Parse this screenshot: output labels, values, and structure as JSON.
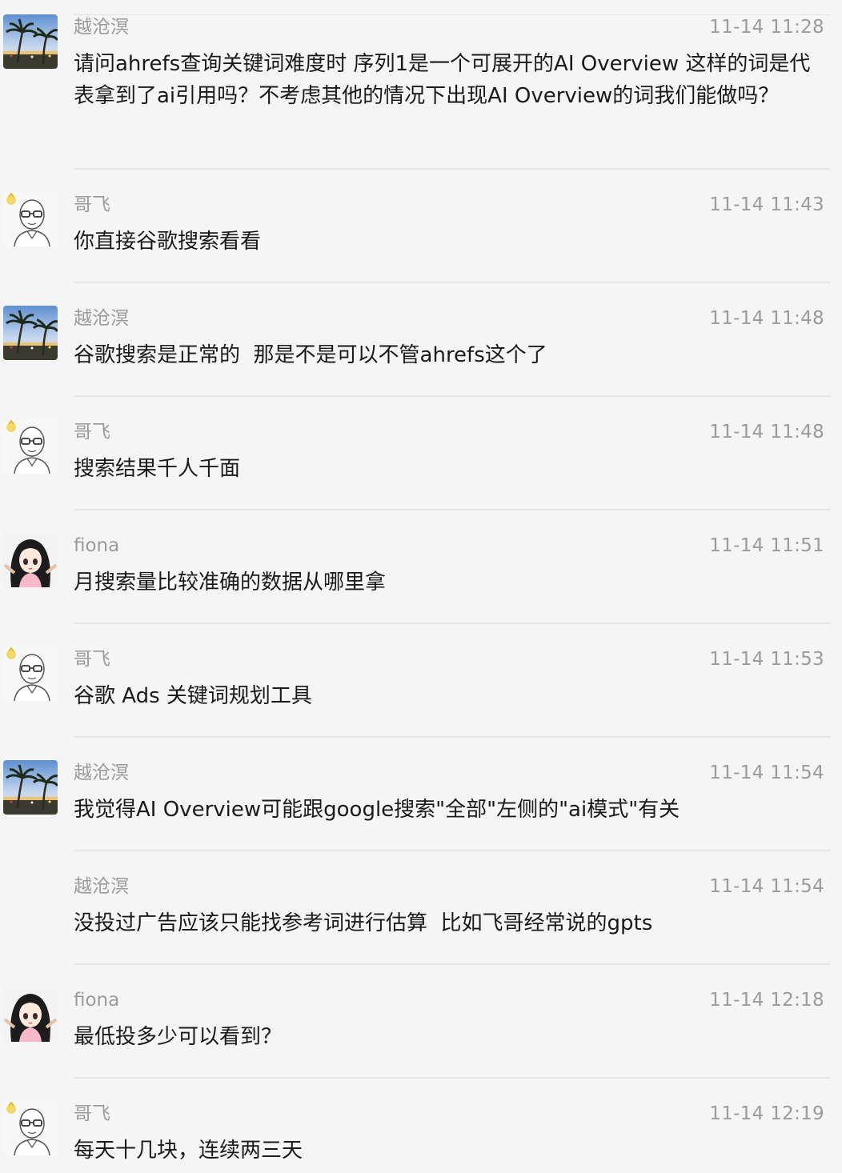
{
  "messages": [
    {
      "sender": "越沧溟",
      "avatar": "palm-beach-avatar",
      "time": "11-14 11:28",
      "text": "请问ahrefs查询关键词难度时 序列1是一个可展开的AI Overview 这样的词是代表拿到了ai引用吗？不考虑其他的情况下出现AI Overview的词我们能做吗？"
    },
    {
      "sender": "哥飞",
      "avatar": "bald-glasses-avatar",
      "time": "11-14 11:43",
      "text": "你直接谷歌搜索看看"
    },
    {
      "sender": "越沧溟",
      "avatar": "palm-beach-avatar",
      "time": "11-14 11:48",
      "text": "谷歌搜索是正常的  那是不是可以不管ahrefs这个了"
    },
    {
      "sender": "哥飞",
      "avatar": "bald-glasses-avatar",
      "time": "11-14 11:48",
      "text": "搜索结果千人千面"
    },
    {
      "sender": "fiona",
      "avatar": "anime-girl-avatar",
      "time": "11-14 11:51",
      "text": "月搜索量比较准确的数据从哪里拿"
    },
    {
      "sender": "哥飞",
      "avatar": "bald-glasses-avatar",
      "time": "11-14 11:53",
      "text": "谷歌 Ads 关键词规划工具"
    },
    {
      "sender": "越沧溟",
      "avatar": "palm-beach-avatar",
      "time": "11-14 11:54",
      "text": "我觉得AI Overview可能跟google搜索\"全部\"左侧的\"ai模式\"有关"
    },
    {
      "sender": "越沧溟",
      "avatar": "",
      "time": "11-14 11:54",
      "text": "没投过广告应该只能找参考词进行估算  比如飞哥经常说的gpts"
    },
    {
      "sender": "fiona",
      "avatar": "anime-girl-avatar",
      "time": "11-14 12:18",
      "text": "最低投多少可以看到？"
    },
    {
      "sender": "哥飞",
      "avatar": "bald-glasses-avatar",
      "time": "11-14 12:19",
      "text": "每天十几块，连续两三天"
    }
  ]
}
